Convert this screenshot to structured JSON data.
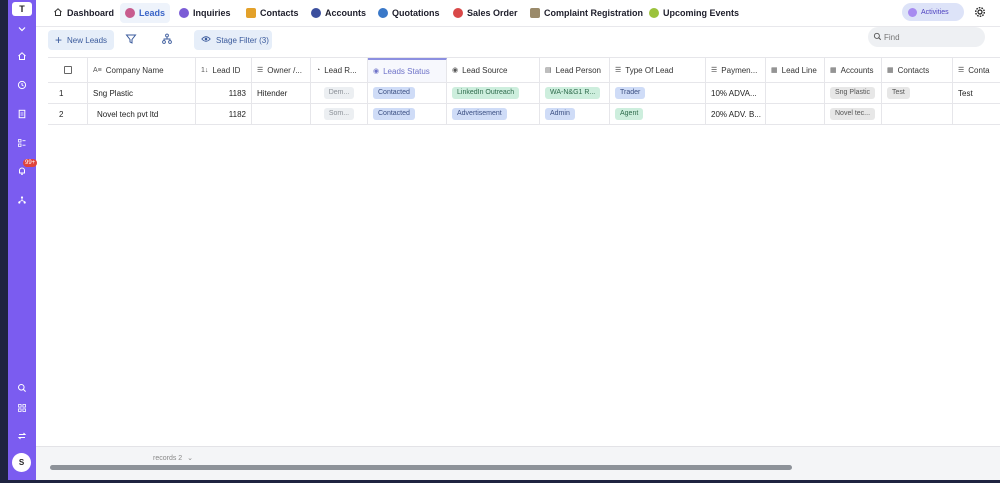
{
  "sidebar": {
    "workspace_initial": "T",
    "notification_badge": "99+",
    "avatar_initial": "S",
    "icons": [
      "chevron-down-icon",
      "home-icon",
      "clock-icon",
      "document-icon",
      "grid-list-icon",
      "bell-icon",
      "network-icon",
      "search-icon",
      "apps-icon",
      "swap-icon"
    ]
  },
  "tabs": [
    {
      "label": "Dashboard",
      "icon": "home-icon"
    },
    {
      "label": "Leads",
      "icon": "leads-icon",
      "active": true
    },
    {
      "label": "Inquiries",
      "icon": "inquiries-icon"
    },
    {
      "label": "Contacts",
      "icon": "contacts-icon"
    },
    {
      "label": "Accounts",
      "icon": "accounts-icon"
    },
    {
      "label": "Quotations",
      "icon": "quotations-icon"
    },
    {
      "label": "Sales Order",
      "icon": "sales-order-icon"
    },
    {
      "label": "Complaint Registration",
      "icon": "complaint-icon"
    },
    {
      "label": "Upcoming Events",
      "icon": "events-icon"
    }
  ],
  "header": {
    "activities_label": "Activities"
  },
  "toolbar": {
    "new_leads_label": "New Leads",
    "stage_filter_label": "Stage Filter (3)",
    "find_placeholder": "Find"
  },
  "table": {
    "columns": [
      "Company Name",
      "Lead ID",
      "Owner /...",
      "Lead R...",
      "Leads Status",
      "Lead Source",
      "Lead Person",
      "Type Of Lead",
      "Paymen...",
      "Lead Line",
      "Accounts",
      "Contacts",
      "Conta"
    ],
    "rows": [
      {
        "index": "1",
        "company": "Sng Plastic",
        "lead_id": "1183",
        "owner": "Hitender",
        "lead_r": "Dem...",
        "status": "Contacted",
        "source": "LinkedIn Outreach",
        "person": "WA-N&G1 R...",
        "type": "Trader",
        "payment": "10% ADVA...",
        "lead_line": "",
        "accounts": "Sng Plastic",
        "contacts": "Test",
        "conta": "Test"
      },
      {
        "index": "2",
        "company": "Novel tech pvt ltd",
        "lead_id": "1182",
        "owner": "",
        "lead_r": "Som...",
        "status": "Contacted",
        "source": "Advertisement",
        "person": "Admin",
        "type": "Agent",
        "payment": "20% ADV. B...",
        "lead_line": "",
        "accounts": "Novel tec...",
        "contacts": "",
        "conta": ""
      }
    ]
  },
  "footer": {
    "records_label": "records 2"
  },
  "colors": {
    "sidebar": "#7b5cf0",
    "accent": "#3a64c8",
    "chip_blue": "#cfdcf7",
    "chip_green": "#cdeedd"
  }
}
